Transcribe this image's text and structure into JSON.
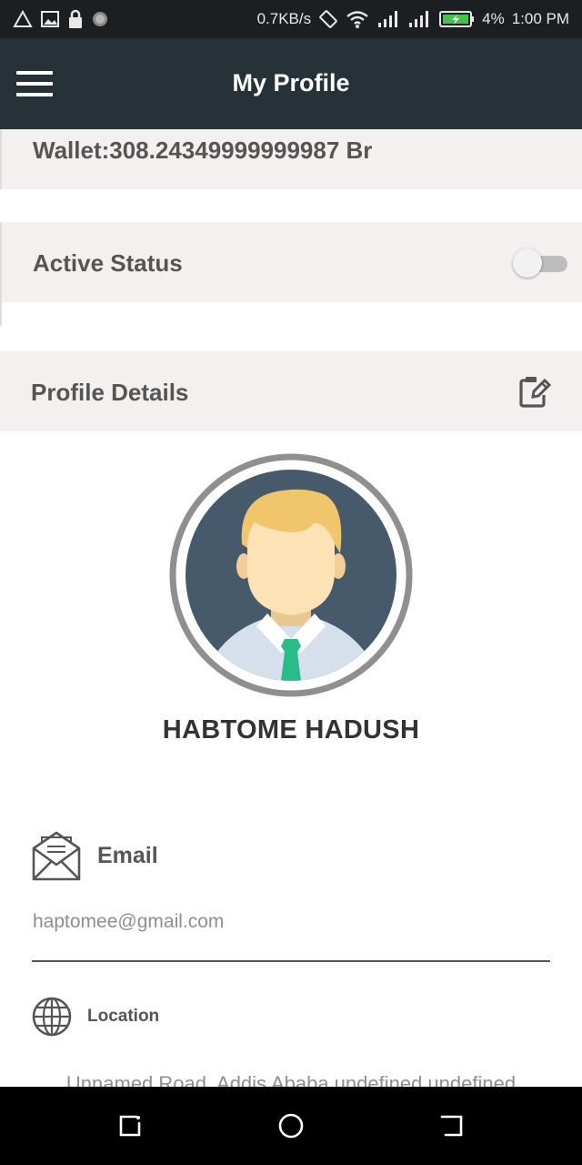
{
  "status_bar": {
    "net_speed": "0.7KB/s",
    "battery": "4%",
    "time": "1:00 PM",
    "icons": [
      "alert-triangle-icon",
      "image-icon",
      "lock-icon",
      "circle-icon",
      "rotate-icon",
      "wifi-icon",
      "signal-icon",
      "signal-icon",
      "battery-charging-icon"
    ]
  },
  "app_bar": {
    "title": "My Profile",
    "menu_icon": "hamburger-menu-icon"
  },
  "wallet": {
    "text": "Wallet:308.24349999999987 Br"
  },
  "active_status": {
    "label": "Active Status",
    "enabled": false
  },
  "profile_details": {
    "label": "Profile Details",
    "edit_icon": "edit-icon"
  },
  "user": {
    "name": "HABTOME HADUSH"
  },
  "email": {
    "label": "Email",
    "value": "haptomee@gmail.com",
    "icon": "envelope-open-icon"
  },
  "location": {
    "label": "Location",
    "value": "Unnamed Road, Addis Ababa undefined undefined",
    "icon": "globe-icon"
  },
  "nav_bar": {
    "icons": [
      "recent-apps-icon",
      "home-icon",
      "back-icon"
    ]
  },
  "colors": {
    "app_bar": "#263238",
    "status_bar": "#1c1f22",
    "section_bg": "#f4f0f0",
    "text_dark": "#555555",
    "text_muted": "#8e8e8e",
    "tie": "#2bbb8a"
  }
}
